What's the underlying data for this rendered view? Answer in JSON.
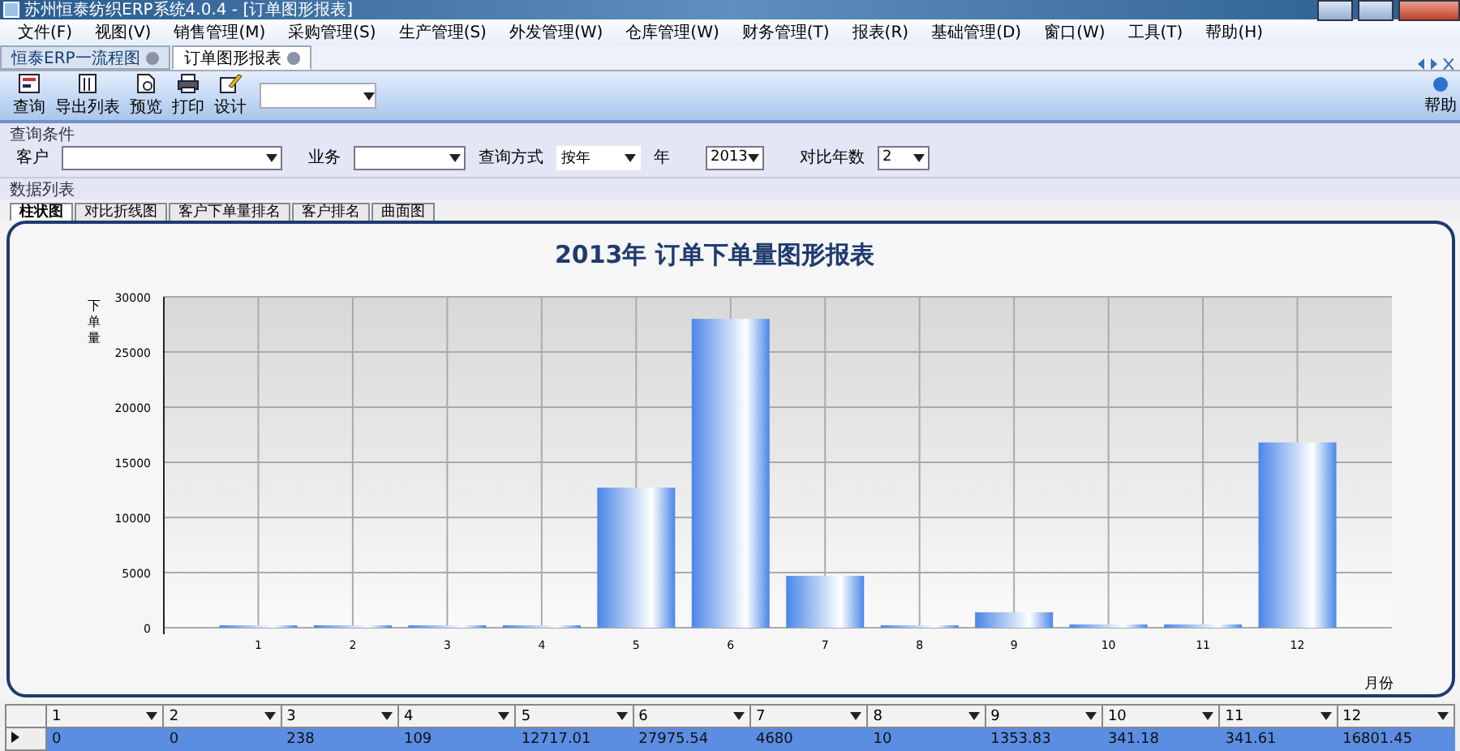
{
  "window": {
    "title": "苏州恒泰纺织ERP系统4.0.4 - [订单图形报表]"
  },
  "menu": [
    "文件(F)",
    "视图(V)",
    "销售管理(M)",
    "采购管理(S)",
    "生产管理(S)",
    "外发管理(W)",
    "仓库管理(W)",
    "财务管理(T)",
    "报表(R)",
    "基础管理(D)",
    "窗口(W)",
    "工具(T)",
    "帮助(H)"
  ],
  "doc_tabs": [
    {
      "label": "恒泰ERP一流程图",
      "selected": false
    },
    {
      "label": "订单图形报表",
      "selected": true
    }
  ],
  "toolbar": {
    "buttons": [
      {
        "label": "查询",
        "kind": "query"
      },
      {
        "label": "导出列表",
        "kind": "export"
      },
      {
        "label": "预览",
        "kind": "preview"
      },
      {
        "label": "打印",
        "kind": "print"
      },
      {
        "label": "设计",
        "kind": "design"
      }
    ],
    "help": "帮助"
  },
  "query": {
    "title": "查询条件",
    "customer_label": "客户",
    "business_label": "业务",
    "mode_label": "查询方式",
    "mode_value": "按年",
    "year_label": "年",
    "year_value": "2013",
    "compare_label": "对比年数",
    "compare_value": "2"
  },
  "data_list": {
    "title": "数据列表"
  },
  "chart_tabs": [
    {
      "label": "柱状图",
      "selected": true
    },
    {
      "label": "对比折线图",
      "selected": false
    },
    {
      "label": "客户下单量排名",
      "selected": false
    },
    {
      "label": "客户排名",
      "selected": false
    },
    {
      "label": "曲面图",
      "selected": false
    }
  ],
  "chart": {
    "chart_data": {
      "type": "bar",
      "title": "2013年 订单下单量图形报表",
      "ylabel": "下单量",
      "xlabel": "月份",
      "categories": [
        "1",
        "2",
        "3",
        "4",
        "5",
        "6",
        "7",
        "8",
        "9",
        "10",
        "11",
        "12"
      ],
      "values": [
        0,
        0,
        200,
        100,
        12700,
        28000,
        4700,
        0,
        1400,
        300,
        300,
        16800
      ],
      "grid": true,
      "ylim": [
        0,
        30000
      ],
      "yticks": [
        0,
        5000,
        10000,
        15000,
        20000,
        25000,
        30000
      ]
    }
  },
  "grid": {
    "columns": [
      "1",
      "2",
      "3",
      "4",
      "5",
      "6",
      "7",
      "8",
      "9",
      "10",
      "11",
      "12"
    ],
    "rows": [
      {
        "selected": true,
        "cells": [
          "0",
          "0",
          "238",
          "109",
          "12717.01",
          "27975.54",
          "4680",
          "10",
          "1353.83",
          "341.18",
          "341.61",
          "16801.45"
        ]
      }
    ]
  }
}
